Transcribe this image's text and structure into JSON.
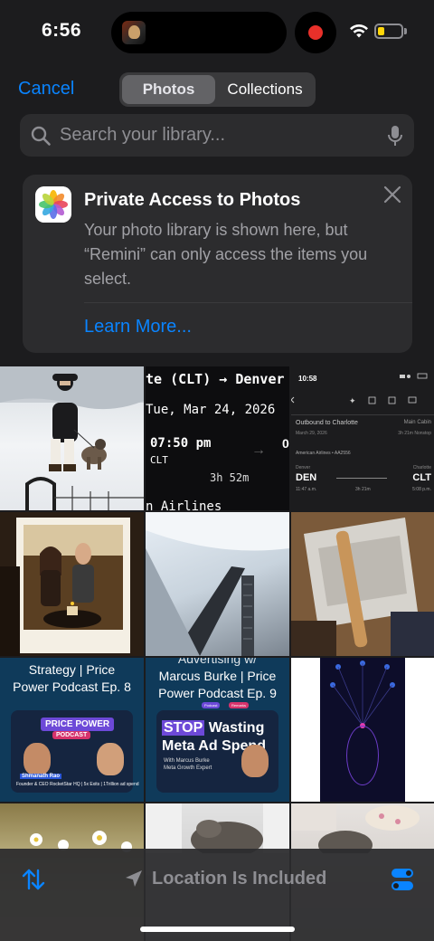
{
  "status_bar": {
    "time": "6:56",
    "battery_level": 0.3,
    "battery_color": "#ffd60a",
    "recording_color": "#e8302a"
  },
  "nav": {
    "cancel_label": "Cancel",
    "tabs": [
      {
        "label": "Photos",
        "selected": true
      },
      {
        "label": "Collections",
        "selected": false
      }
    ]
  },
  "search": {
    "placeholder": "Search your library..."
  },
  "notice": {
    "title": "Private Access to Photos",
    "body": "Your photo library is shown here, but “Remini” can only access the items you select.",
    "link": "Learn More..."
  },
  "grid": {
    "flight": {
      "route": "te (CLT) → Denver (DE",
      "date": "Tue, Mar 24, 2026",
      "time": "07:50 pm",
      "code": "CLT",
      "duration": "3h 52m",
      "airline": "n Airlines",
      "arrival_partial": "0"
    },
    "flight_app": {
      "time": "10:58",
      "outbound": "Outbound to Charlotte",
      "cabin": "Main Cabin",
      "date": "March 29, 2026",
      "duration_nonstop": "3h 21m  Nonstop",
      "airline": "American Airlines • AA2556",
      "origin_label": "Denver",
      "origin": "DEN",
      "dest_label": "Charlotte",
      "dest": "CLT",
      "depart_time": "11:47 a.m.",
      "flight_duration": "3h 21m",
      "arrive_time": "5:08 p.m."
    },
    "podcast8": {
      "title_line1": "Strategy | Price",
      "title_line2": "Power Podcast Ep. 8",
      "badge": "PRICE POWER",
      "badge2": "PODCAST",
      "guest": "Shmanath Rao",
      "caption": "Founder & CEO RocketStar HQ | 5x Exits | 1Trillion ad spend"
    },
    "podcast9": {
      "title_line0": "Advertising w/",
      "title_line1": "Marcus Burke | Price",
      "title_line2": "Power Podcast Ep. 9",
      "pill1": "Podcast",
      "pill2": "Remarks",
      "headline_stop": "STOP",
      "headline_rest": " Wasting",
      "headline_line2": "Meta Ad Spend",
      "with_line1": "With Marcus Burke",
      "with_line2": "Meta Growth Expert"
    }
  },
  "toolbar": {
    "sort_icon": "sort-arrows-icon",
    "location_label": "Location Is Included",
    "filter_icon": "toggle-filter-icon",
    "accent_color": "#0a84ff"
  }
}
